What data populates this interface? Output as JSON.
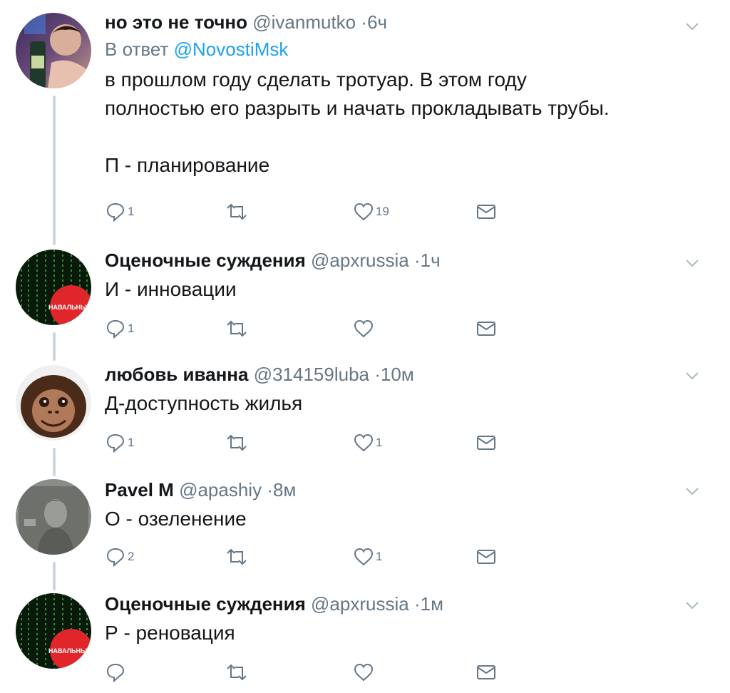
{
  "tweets": [
    {
      "name": "но это не точно",
      "handle": "@ivanmutko",
      "time": "6ч",
      "reply_to_prefix": "В ответ",
      "reply_to": "@NovostiMsk",
      "text_lines": [
        "в прошлом году сделать тротуар. В этом году",
        "полностью его разрыть и начать прокладывать трубы.",
        "",
        "П - планирование"
      ],
      "replies": "1",
      "retweets": "",
      "likes": "19"
    },
    {
      "name": "Оценочные суждения",
      "handle": "@apxrussia",
      "time": "1ч",
      "text": "И - инновации",
      "avatar_badge": "НАВАЛЬНЫЙ",
      "replies": "1",
      "retweets": "",
      "likes": ""
    },
    {
      "name": "любовь иванна",
      "handle": "@314159luba",
      "time": "10м",
      "text": "Д-доступность жилья",
      "replies": "1",
      "retweets": "",
      "likes": "1"
    },
    {
      "name": "Pavel M",
      "handle": "@apashiy",
      "time": "8м",
      "text": "О - озеленение",
      "replies": "2",
      "retweets": "",
      "likes": "1"
    },
    {
      "name": "Оценочные суждения",
      "handle": "@apxrussia",
      "time": "1м",
      "text": "Р - реновация",
      "avatar_badge": "НАВАЛЬНЫЙ",
      "replies": "",
      "retweets": "",
      "likes": ""
    }
  ],
  "dot": "·",
  "colors": {
    "text": "#14171a",
    "secondary": "#657786",
    "link": "#1da1f2",
    "thread": "#ccd6dd",
    "badge": "#e0262a"
  }
}
